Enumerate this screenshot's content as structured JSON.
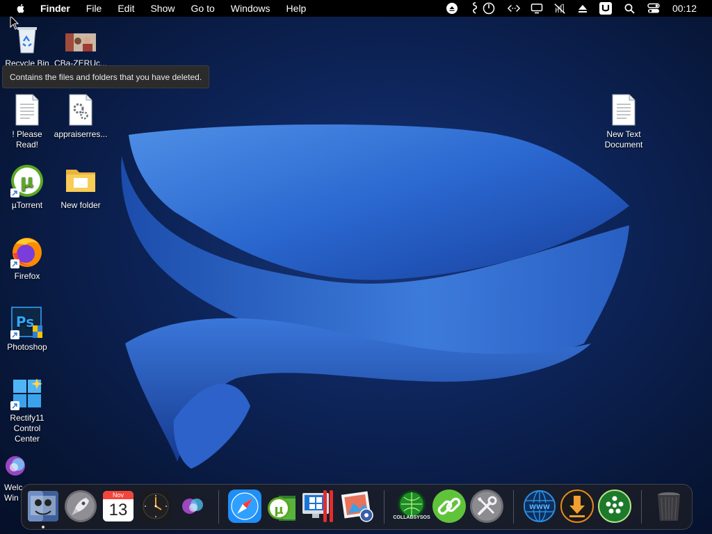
{
  "menubar": {
    "app": "Finder",
    "items": [
      "File",
      "Edit",
      "Show",
      "Go to",
      "Windows",
      "Help"
    ],
    "clock": "00:12"
  },
  "desktop": {
    "icons": {
      "recycle_bin": "Recycle Bin",
      "cba": "CBa-ZERUc...",
      "please_read": "! Please Read!",
      "appraiser": "appraiserres...",
      "utorrent": "µTorrent",
      "new_folder": "New folder",
      "firefox": "Firefox",
      "photoshop": "Photoshop",
      "rectify": "Rectify11 Control Center",
      "welcome": "Welc Win",
      "new_text": "New Text Document"
    },
    "tooltip": "Contains the files and folders that you have deleted."
  },
  "dock": {
    "calendar_month": "Nov",
    "calendar_day": "13",
    "collab_label": "COLLABSYSOS"
  },
  "colors": {
    "accent": "#1e6be0",
    "wallpaper_dark": "#081739"
  }
}
